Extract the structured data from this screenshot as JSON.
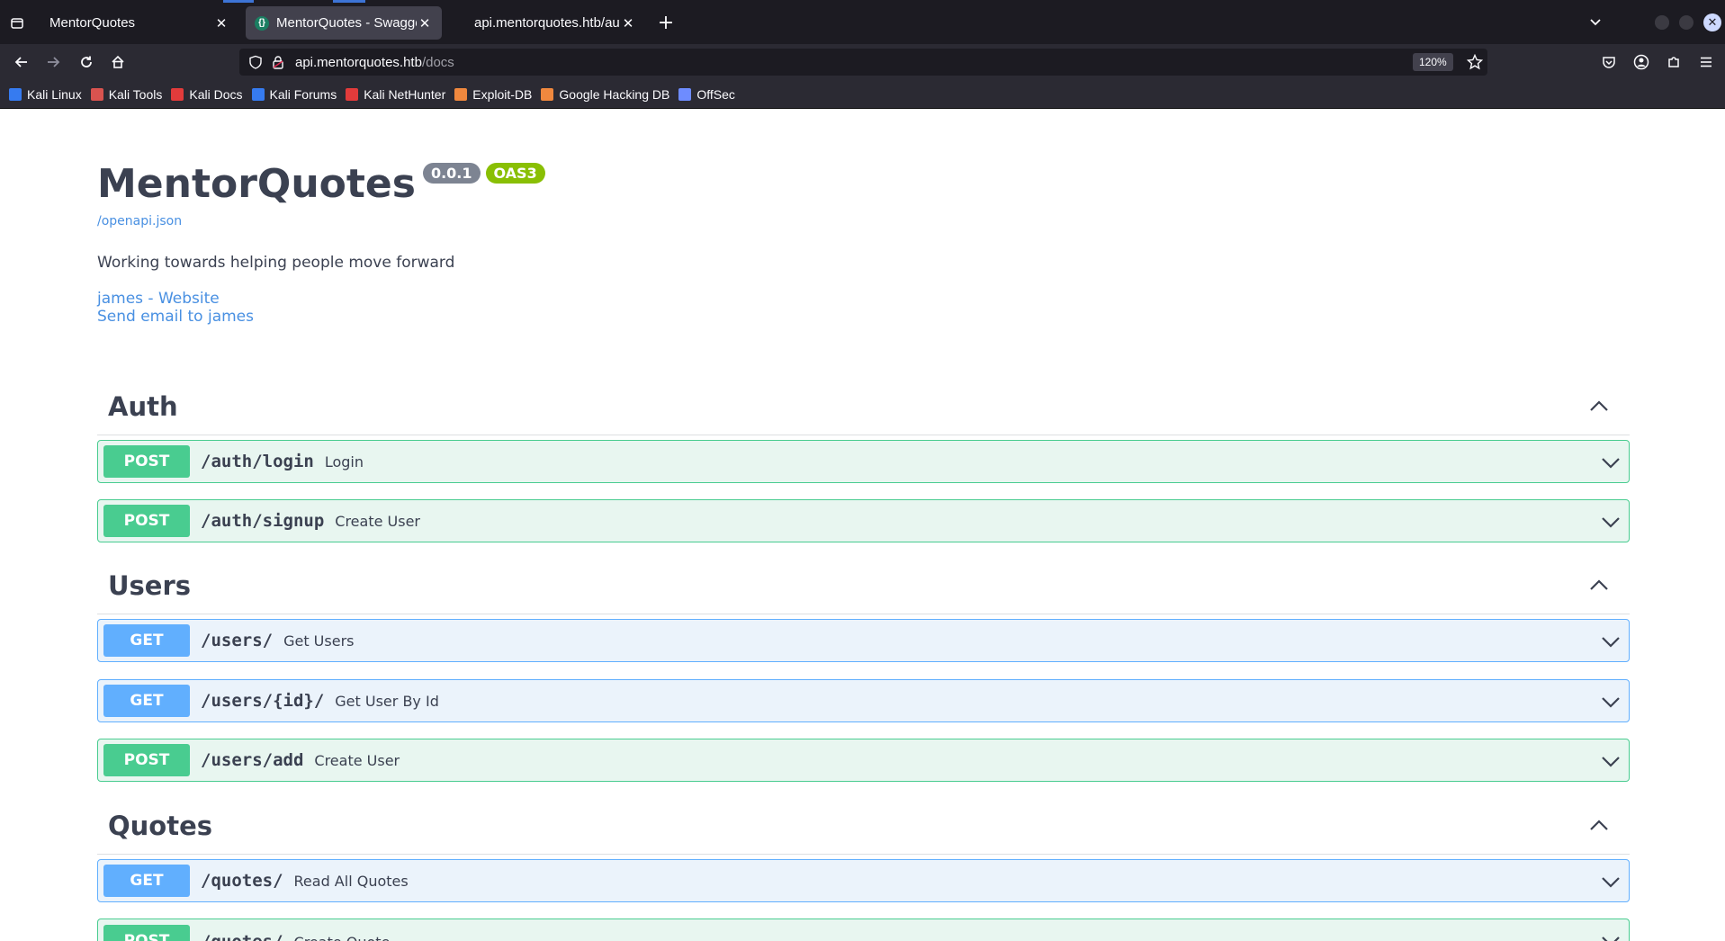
{
  "browser": {
    "tabs": [
      {
        "title": "MentorQuotes",
        "active": false
      },
      {
        "title": "MentorQuotes - Swagger UI",
        "active": true
      },
      {
        "title": "api.mentorquotes.htb/auth/login",
        "active": false
      }
    ],
    "url_host": "api.mentorquotes.htb",
    "url_path": "/docs",
    "zoom": "120%",
    "bookmarks": [
      {
        "label": "Kali Linux",
        "color": "#367bf0"
      },
      {
        "label": "Kali Tools",
        "color": "#d9534f"
      },
      {
        "label": "Kali Docs",
        "color": "#e23b3b"
      },
      {
        "label": "Kali Forums",
        "color": "#367bf0"
      },
      {
        "label": "Kali NetHunter",
        "color": "#e23b3b"
      },
      {
        "label": "Exploit-DB",
        "color": "#f0883e"
      },
      {
        "label": "Google Hacking DB",
        "color": "#f0883e"
      },
      {
        "label": "OffSec",
        "color": "#6e8cff"
      }
    ]
  },
  "info": {
    "title": "MentorQuotes",
    "version": "0.0.1",
    "oas": "OAS3",
    "spec_url": "/openapi.json",
    "description": "Working towards helping people move forward",
    "contact_website": "james - Website",
    "contact_email": "Send email to james"
  },
  "sections": [
    {
      "name": "Auth",
      "operations": [
        {
          "method": "POST",
          "path": "/auth/login",
          "summary": "Login"
        },
        {
          "method": "POST",
          "path": "/auth/signup",
          "summary": "Create User"
        }
      ]
    },
    {
      "name": "Users",
      "operations": [
        {
          "method": "GET",
          "path": "/users/",
          "summary": "Get Users"
        },
        {
          "method": "GET",
          "path": "/users/{id}/",
          "summary": "Get User By Id"
        },
        {
          "method": "POST",
          "path": "/users/add",
          "summary": "Create User"
        }
      ]
    },
    {
      "name": "Quotes",
      "operations": [
        {
          "method": "GET",
          "path": "/quotes/",
          "summary": "Read All Quotes"
        },
        {
          "method": "POST",
          "path": "/quotes/",
          "summary": "Create Quote"
        }
      ]
    }
  ]
}
